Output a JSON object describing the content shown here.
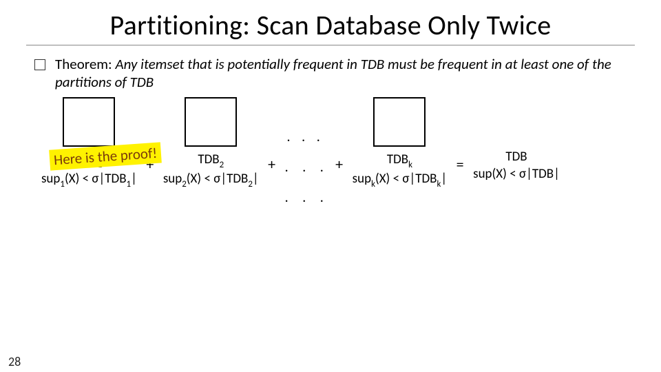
{
  "title": "Partitioning: Scan Database Only Twice",
  "theorem_lead": "Theorem:",
  "theorem_body": "Any itemset that is potentially frequent in TDB must be frequent in at least one of the partitions of TDB",
  "highlight": "Here is the proof!",
  "p1_name": "TDB",
  "p1_sub": "1",
  "p1_cond_a": "sup",
  "p1_cond_b": "(X) < σ|TDB",
  "p1_cond_c": "|",
  "p2_name": "TDB",
  "p2_sub": "2",
  "p2_cond_a": "sup",
  "p2_cond_b": "(X) < σ|TDB",
  "p2_cond_c": "|",
  "pk_name": "TDB",
  "pk_sub": "k",
  "pk_cond_a": "sup",
  "pk_cond_b": "(X) < σ|TDB",
  "pk_cond_c": "|",
  "sum_name": "TDB",
  "sum_cond": "sup(X) < σ|TDB|",
  "op_plus": "+",
  "op_eq": "=",
  "dots_top": ". . .",
  "dots_mid": ". . .",
  "dots_low": ". . .",
  "page": "28"
}
